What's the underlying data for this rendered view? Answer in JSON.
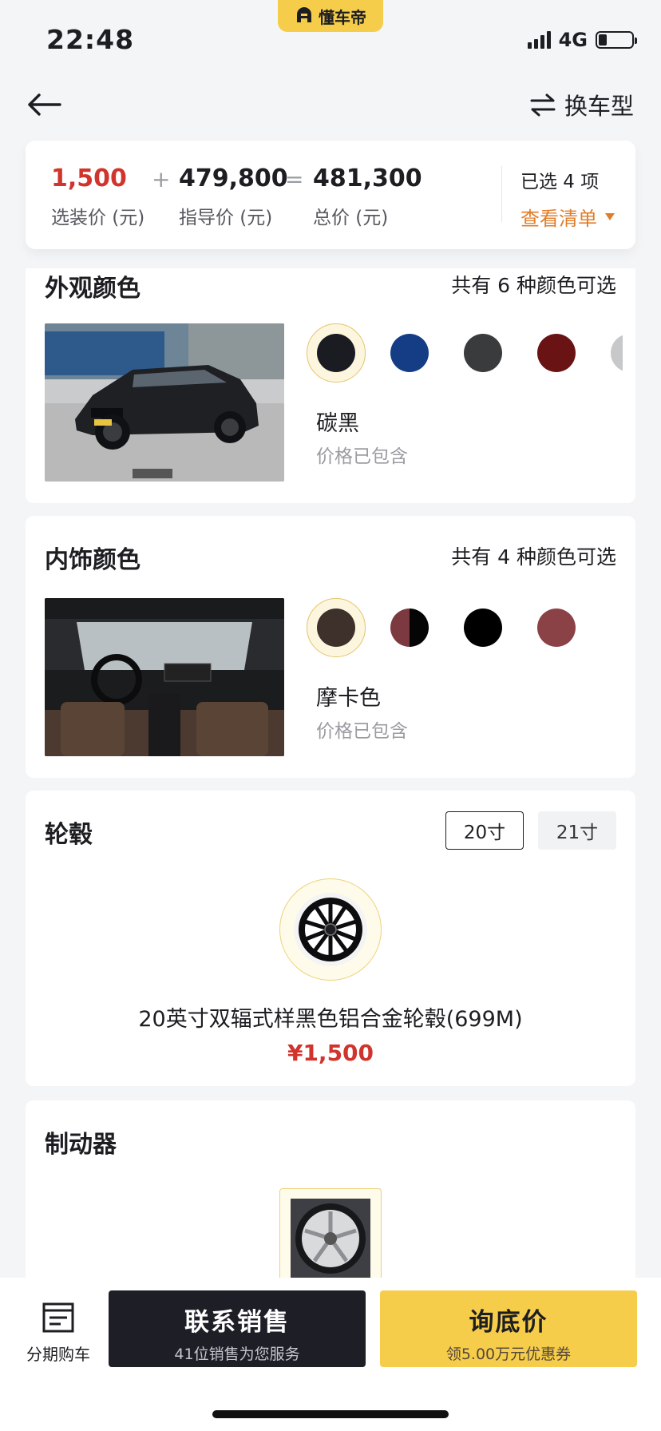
{
  "status_bar": {
    "time": "22:48",
    "network": "4G",
    "brand": "懂车帝",
    "battery_level": 0.25
  },
  "nav": {
    "back_icon": "arrow-left-icon",
    "switch_label": "换车型",
    "switch_icon": "swap-arrows-icon"
  },
  "price_summary": {
    "option_price": "1,500",
    "option_label": "选装价 (元)",
    "plus": "+",
    "guide_price": "479,800",
    "guide_label": "指导价 (元)",
    "equals": "=",
    "total_price": "481,300",
    "total_label": "总价 (元)",
    "selected_text": "已选 4 项",
    "view_list": "查看清单",
    "accent_color": "#d0342c"
  },
  "exterior": {
    "title": "外观颜色",
    "count_text": "共有 6 种颜色可选",
    "selected_name": "碳黑",
    "selected_sub": "价格已包含",
    "swatches": [
      "#1b1c21",
      "#143d86",
      "#3a3b3d",
      "#6a1315",
      "#c7c8ca"
    ]
  },
  "interior": {
    "title": "内饰颜色",
    "count_text": "共有 4 种颜色可选",
    "selected_name": "摩卡色",
    "selected_sub": "价格已包含",
    "swatches": [
      "#3e302a",
      "split:#7c3a40:#050505",
      "#000000",
      "#8a4247"
    ]
  },
  "wheels": {
    "title": "轮毂",
    "tabs": [
      "20寸",
      "21寸"
    ],
    "active_tab": "20寸",
    "name": "20英寸双辐式样黑色铝合金轮毂(699M)",
    "price": "¥1,500"
  },
  "brakes": {
    "title": "制动器"
  },
  "bottom_bar": {
    "installment_label": "分期购车",
    "installment_icon": "document-icon",
    "contact_main": "联系销售",
    "contact_sub": "41位销售为您服务",
    "price_main": "询底价",
    "price_sub": "领5.00万元优惠券"
  }
}
